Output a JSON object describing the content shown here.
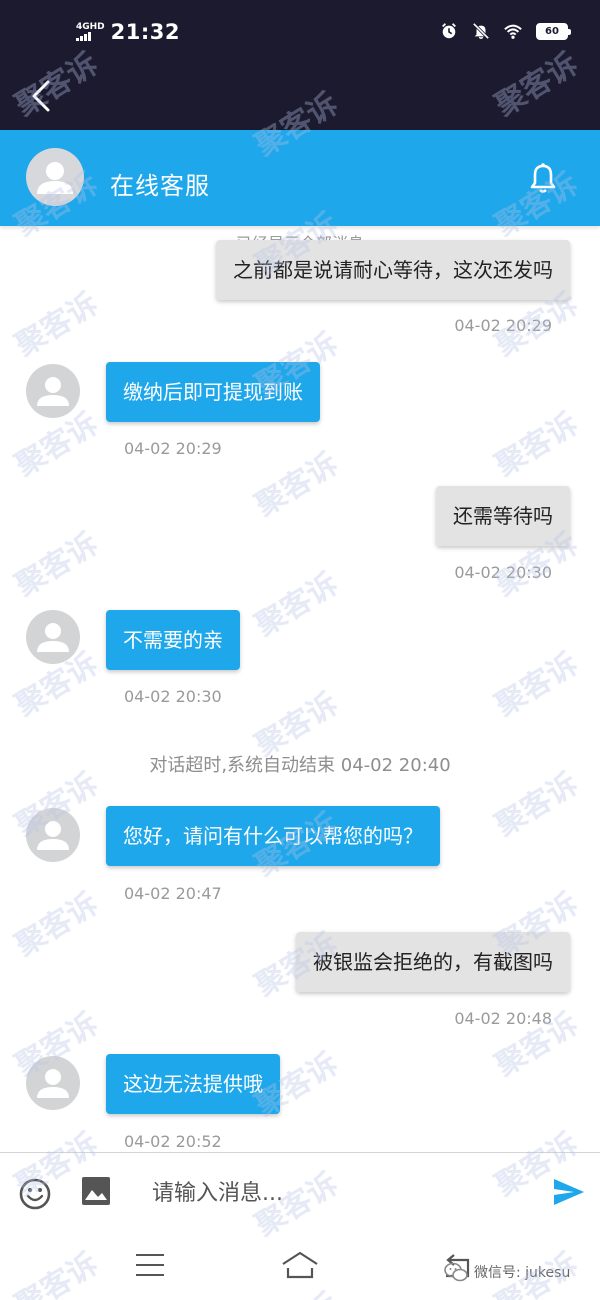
{
  "status_bar": {
    "network_label": "4GHD",
    "time": "21:32",
    "battery": "60",
    "icons": [
      "alarm-icon",
      "mute-icon",
      "wifi-icon",
      "battery-icon"
    ]
  },
  "nav": {
    "back_icon": "chevron-left-icon"
  },
  "header": {
    "title": "在线客服",
    "avatar_icon": "person-icon",
    "bell_icon": "bell-icon",
    "accent_color": "#1ea7ea"
  },
  "chat": {
    "all_loaded_note": "已经显示全部消息",
    "messages": [
      {
        "side": "out",
        "text": "之前都是说请耐心等待，这次还发吗",
        "time": "04-02 20:29"
      },
      {
        "side": "in",
        "text": "缴纳后即可提现到账",
        "time": "04-02 20:29"
      },
      {
        "side": "out",
        "text": "还需等待吗",
        "time": "04-02 20:30"
      },
      {
        "side": "in",
        "text": "不需要的亲",
        "time": "04-02 20:30"
      },
      {
        "side": "in",
        "text": "您好，请问有什么可以帮您的吗？",
        "time": "04-02 20:47"
      },
      {
        "side": "out",
        "text": "被银监会拒绝的，有截图吗",
        "time": "04-02 20:48"
      },
      {
        "side": "in",
        "text": "这边无法提供哦",
        "time": "04-02 20:52"
      }
    ],
    "timeout_note": "对话超时,系统自动结束 04-02 20:40"
  },
  "input": {
    "placeholder": "请输入消息...",
    "emoji_icon": "emoji-icon",
    "image_icon": "image-icon",
    "send_icon": "send-icon"
  },
  "system_nav": {
    "icons": [
      "menu-icon",
      "home-icon",
      "back-icon"
    ]
  },
  "watermark": {
    "text": "聚客诉",
    "wechat_label": "微信号: jukesu"
  }
}
